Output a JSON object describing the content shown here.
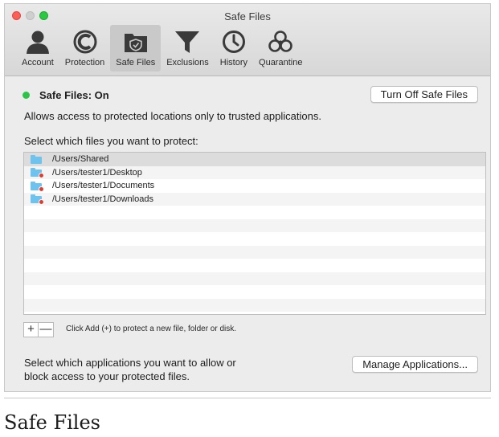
{
  "window": {
    "title": "Safe Files"
  },
  "toolbar": {
    "items": [
      {
        "label": "Account",
        "icon": "account-icon",
        "active": false
      },
      {
        "label": "Protection",
        "icon": "protection-icon",
        "active": false
      },
      {
        "label": "Safe Files",
        "icon": "safe-files-icon",
        "active": true
      },
      {
        "label": "Exclusions",
        "icon": "exclusions-funnel-icon",
        "active": false
      },
      {
        "label": "History",
        "icon": "history-clock-icon",
        "active": false
      },
      {
        "label": "Quarantine",
        "icon": "quarantine-biohazard-icon",
        "active": false
      }
    ]
  },
  "status": {
    "text": "Safe Files: On",
    "color": "#2bc448",
    "toggle_button": "Turn Off Safe Files"
  },
  "description": "Allows access to protected locations only to trusted applications.",
  "files_section": {
    "label": "Select which files you want to protect:",
    "files": [
      {
        "path": "/Users/Shared",
        "badge": false
      },
      {
        "path": "/Users/tester1/Desktop",
        "badge": true
      },
      {
        "path": "/Users/tester1/Documents",
        "badge": true
      },
      {
        "path": "/Users/tester1/Downloads",
        "badge": true
      }
    ],
    "add_label": "+",
    "remove_label": "—",
    "hint": "Click Add (+) to protect a new file, folder or disk."
  },
  "applications": {
    "text_line1": "Select which applications you want to allow or",
    "text_line2": "block access to your protected files.",
    "manage_button": "Manage Applications..."
  },
  "caption": "Safe Files"
}
